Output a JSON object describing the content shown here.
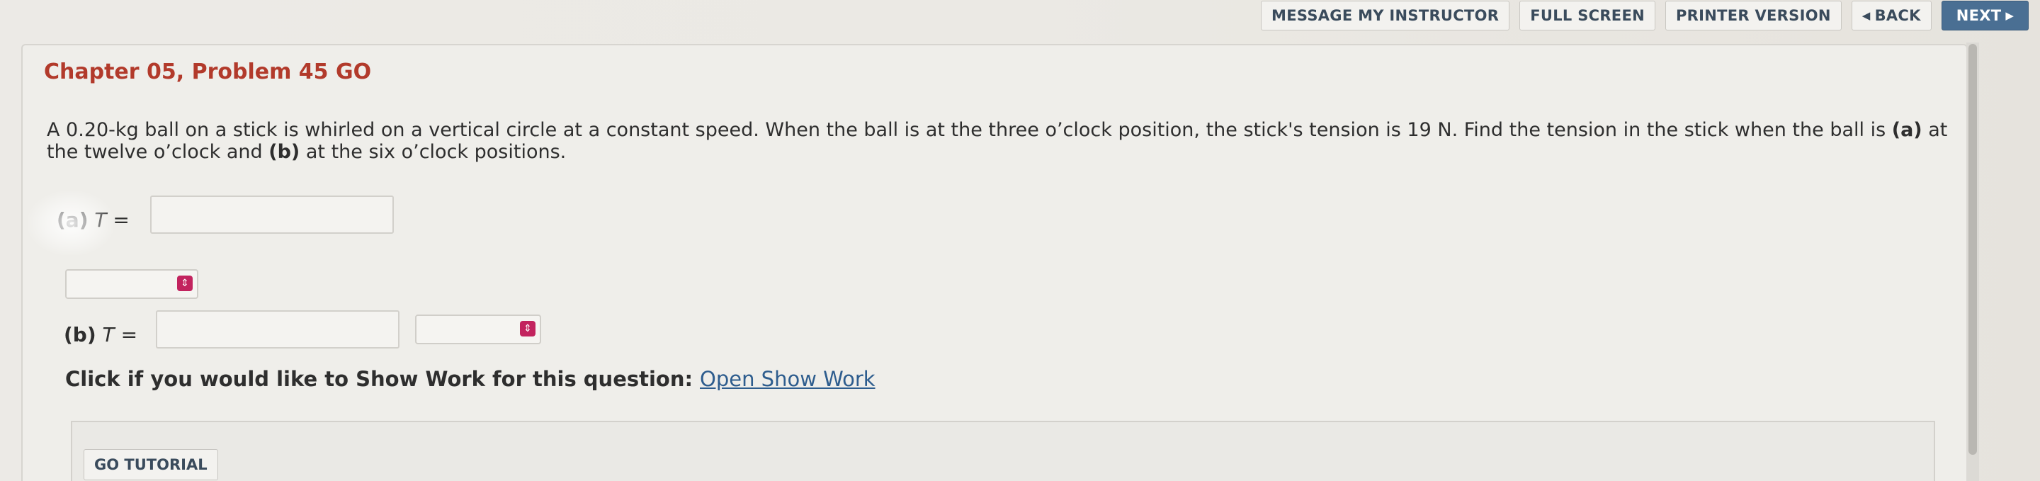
{
  "toolbar": {
    "message_instructor": "MESSAGE MY INSTRUCTOR",
    "full_screen": "FULL SCREEN",
    "printer_version": "PRINTER VERSION",
    "back": "BACK",
    "next": "NEXT",
    "back_icon": "left-triangle-icon",
    "next_icon": "right-triangle-icon"
  },
  "problem": {
    "title": "Chapter 05, Problem 45 GO",
    "text_part1": "A 0.20-kg ball on a stick is whirled on a vertical circle at a constant speed. When the ball is at the three o’clock position, the stick's tension is 19 N. Find the tension in the stick when the ball is ",
    "text_a": "(a)",
    "text_part2": " at the twelve o’clock and ",
    "text_b": "(b)",
    "text_part3": " at the six o’clock positions."
  },
  "parts": {
    "a_label": "(a)",
    "b_label": "(b)",
    "t_var": "T",
    "equals": "=",
    "a_value": "",
    "b_value": "",
    "a_unit": "",
    "b_unit": ""
  },
  "show_work": {
    "prompt": "Click if you would like to Show Work for this question:",
    "link": "Open Show Work"
  },
  "tutorial": {
    "button": "GO TUTORIAL"
  },
  "colors": {
    "title": "#b23a2b",
    "link": "#2e5d8e",
    "next_button": "#4a6f93",
    "select_icon": "#c2235e"
  }
}
